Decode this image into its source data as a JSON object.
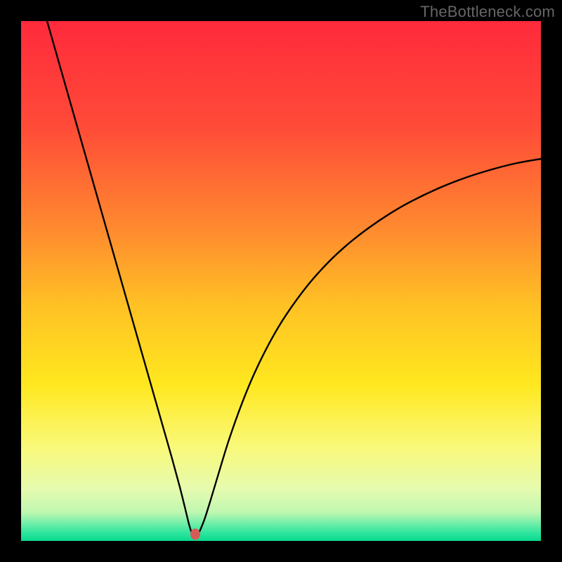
{
  "watermark": "TheBottleneck.com",
  "chart_data": {
    "type": "line",
    "title": "",
    "xlabel": "",
    "ylabel": "",
    "xlim": [
      0,
      100
    ],
    "ylim": [
      0,
      100
    ],
    "grid": false,
    "legend": false,
    "background_gradient": {
      "stops": [
        {
          "offset": 0.0,
          "color": "#ff2a3c"
        },
        {
          "offset": 0.2,
          "color": "#ff4a38"
        },
        {
          "offset": 0.4,
          "color": "#ff8a2f"
        },
        {
          "offset": 0.55,
          "color": "#ffc224"
        },
        {
          "offset": 0.7,
          "color": "#ffe81f"
        },
        {
          "offset": 0.82,
          "color": "#f9f97a"
        },
        {
          "offset": 0.9,
          "color": "#e6fbaf"
        },
        {
          "offset": 0.945,
          "color": "#bff7b0"
        },
        {
          "offset": 0.965,
          "color": "#76efaa"
        },
        {
          "offset": 0.985,
          "color": "#2ce59e"
        },
        {
          "offset": 1.0,
          "color": "#09da8c"
        }
      ]
    },
    "marker": {
      "x": 33.5,
      "y": 1.3,
      "color": "#d85a56",
      "rx": 7,
      "ry": 8
    },
    "series": [
      {
        "name": "bottleneck-curve",
        "color": "#000000",
        "points": [
          {
            "x": 5.0,
            "y": 100.0
          },
          {
            "x": 7.0,
            "y": 93.0
          },
          {
            "x": 10.0,
            "y": 82.5
          },
          {
            "x": 13.0,
            "y": 72.0
          },
          {
            "x": 16.0,
            "y": 61.5
          },
          {
            "x": 19.0,
            "y": 51.0
          },
          {
            "x": 22.0,
            "y": 40.5
          },
          {
            "x": 25.0,
            "y": 30.0
          },
          {
            "x": 27.0,
            "y": 23.0
          },
          {
            "x": 29.0,
            "y": 16.0
          },
          {
            "x": 30.5,
            "y": 10.5
          },
          {
            "x": 31.5,
            "y": 6.5
          },
          {
            "x": 32.3,
            "y": 3.2
          },
          {
            "x": 32.8,
            "y": 1.6
          },
          {
            "x": 33.0,
            "y": 1.2
          },
          {
            "x": 33.5,
            "y": 1.2
          },
          {
            "x": 34.0,
            "y": 1.3
          },
          {
            "x": 34.5,
            "y": 2.2
          },
          {
            "x": 35.3,
            "y": 4.2
          },
          {
            "x": 36.5,
            "y": 8.0
          },
          {
            "x": 38.0,
            "y": 13.0
          },
          {
            "x": 40.0,
            "y": 19.5
          },
          {
            "x": 42.5,
            "y": 26.5
          },
          {
            "x": 45.0,
            "y": 32.5
          },
          {
            "x": 48.0,
            "y": 38.5
          },
          {
            "x": 51.0,
            "y": 43.5
          },
          {
            "x": 55.0,
            "y": 49.0
          },
          {
            "x": 59.0,
            "y": 53.5
          },
          {
            "x": 63.0,
            "y": 57.2
          },
          {
            "x": 67.0,
            "y": 60.3
          },
          {
            "x": 71.0,
            "y": 63.0
          },
          {
            "x": 75.0,
            "y": 65.3
          },
          {
            "x": 80.0,
            "y": 67.7
          },
          {
            "x": 85.0,
            "y": 69.7
          },
          {
            "x": 90.0,
            "y": 71.3
          },
          {
            "x": 95.0,
            "y": 72.6
          },
          {
            "x": 100.0,
            "y": 73.5
          }
        ]
      }
    ]
  }
}
